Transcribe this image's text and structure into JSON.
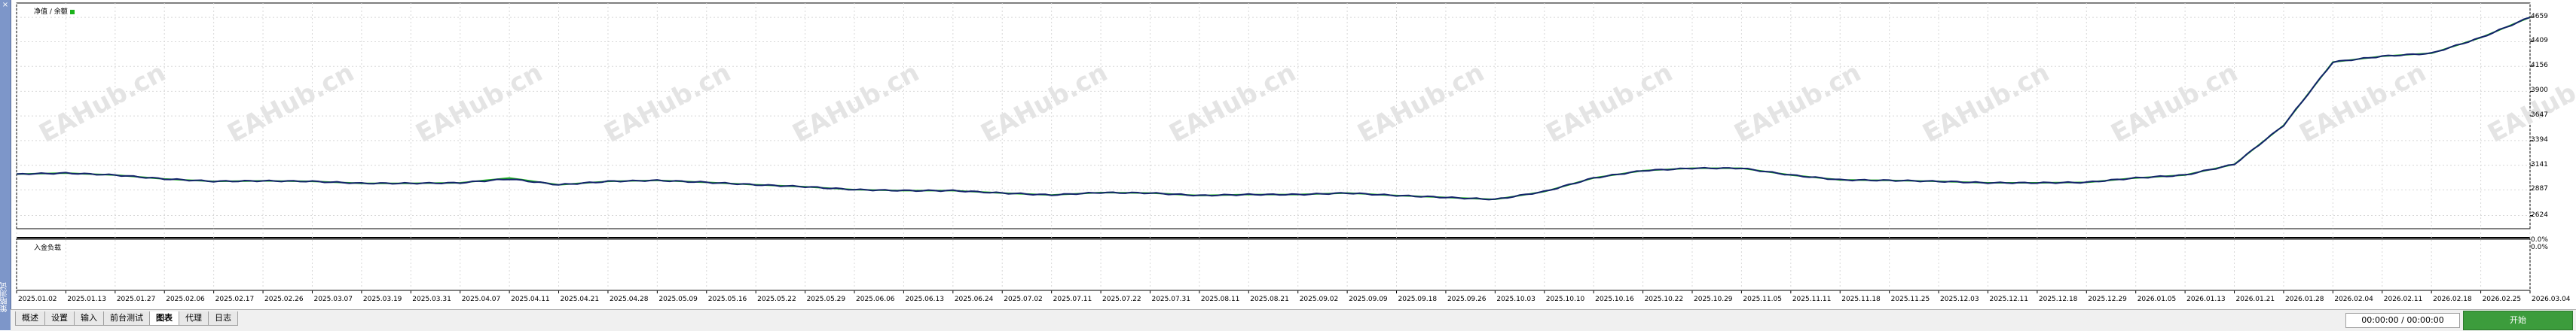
{
  "window": {
    "side_title": "策略测试",
    "close_glyph": "×"
  },
  "legend": {
    "text": "净值 / 余额"
  },
  "sub_panel": {
    "label": "入金负载"
  },
  "watermark": "EAHub.cn",
  "colors": {
    "equity": "#13236b",
    "balance": "#1bb31b",
    "grid": "#d8d8d8"
  },
  "tabs": [
    {
      "label": "概述",
      "active": false
    },
    {
      "label": "设置",
      "active": false
    },
    {
      "label": "输入",
      "active": false
    },
    {
      "label": "前台测试",
      "active": false
    },
    {
      "label": "图表",
      "active": true
    },
    {
      "label": "代理",
      "active": false
    },
    {
      "label": "日志",
      "active": false
    }
  ],
  "status": {
    "time": "00:00:00 / 00:00:00",
    "start_label": "开始"
  },
  "chart_data": {
    "type": "line",
    "x": [
      "2025.01.02",
      "2025.01.13",
      "2025.01.27",
      "2025.02.06",
      "2025.02.17",
      "2025.02.26",
      "2025.03.07",
      "2025.03.19",
      "2025.03.31",
      "2025.04.07",
      "2025.04.11",
      "2025.04.21",
      "2025.04.28",
      "2025.05.09",
      "2025.05.16",
      "2025.05.22",
      "2025.05.29",
      "2025.06.06",
      "2025.06.13",
      "2025.06.24",
      "2025.07.02",
      "2025.07.11",
      "2025.07.22",
      "2025.07.31",
      "2025.08.11",
      "2025.08.21",
      "2025.09.02",
      "2025.09.09",
      "2025.09.18",
      "2025.09.26",
      "2025.10.03",
      "2025.10.10",
      "2025.10.16",
      "2025.10.22",
      "2025.10.29",
      "2025.11.05",
      "2025.11.11",
      "2025.11.18",
      "2025.11.25",
      "2025.12.03",
      "2025.12.11",
      "2025.12.18",
      "2025.12.29",
      "2026.01.05",
      "2026.01.13",
      "2026.01.21",
      "2026.01.28",
      "2026.02.04",
      "2026.02.11",
      "2026.02.18",
      "2026.02.25",
      "2026.03.04"
    ],
    "y_ticks": [
      2624,
      2887,
      3141,
      3394,
      3647,
      3900,
      4156,
      4409,
      4659
    ],
    "ylim": [
      2520,
      4760
    ],
    "series": [
      {
        "values": [
          3050,
          3060,
          3040,
          3000,
          2975,
          2980,
          2975,
          2955,
          2955,
          2960,
          3010,
          2940,
          2975,
          2985,
          2965,
          2940,
          2920,
          2890,
          2880,
          2880,
          2855,
          2835,
          2860,
          2855,
          2830,
          2840,
          2840,
          2855,
          2830,
          2810,
          2790,
          2870,
          3010,
          3085,
          3110,
          3110,
          3040,
          2990,
          2985,
          2975,
          2960,
          2960,
          2965,
          3010,
          3040,
          3150,
          3550,
          4200,
          4260,
          4290,
          4450,
          4660
        ]
      },
      {
        "values": [
          3050,
          3060,
          3040,
          3000,
          2975,
          2980,
          2975,
          2955,
          2955,
          2960,
          3000,
          2940,
          2975,
          2985,
          2965,
          2940,
          2920,
          2890,
          2880,
          2880,
          2855,
          2835,
          2860,
          2855,
          2830,
          2840,
          2840,
          2855,
          2830,
          2810,
          2790,
          2870,
          3010,
          3085,
          3110,
          3110,
          3040,
          2990,
          2985,
          2975,
          2960,
          2960,
          2965,
          3010,
          3040,
          3150,
          3550,
          4200,
          4260,
          4290,
          4450,
          4660
        ]
      }
    ],
    "sub_ticks": [
      "0.0%",
      "0.0%"
    ],
    "grid": true,
    "legend_position": "top-left"
  }
}
